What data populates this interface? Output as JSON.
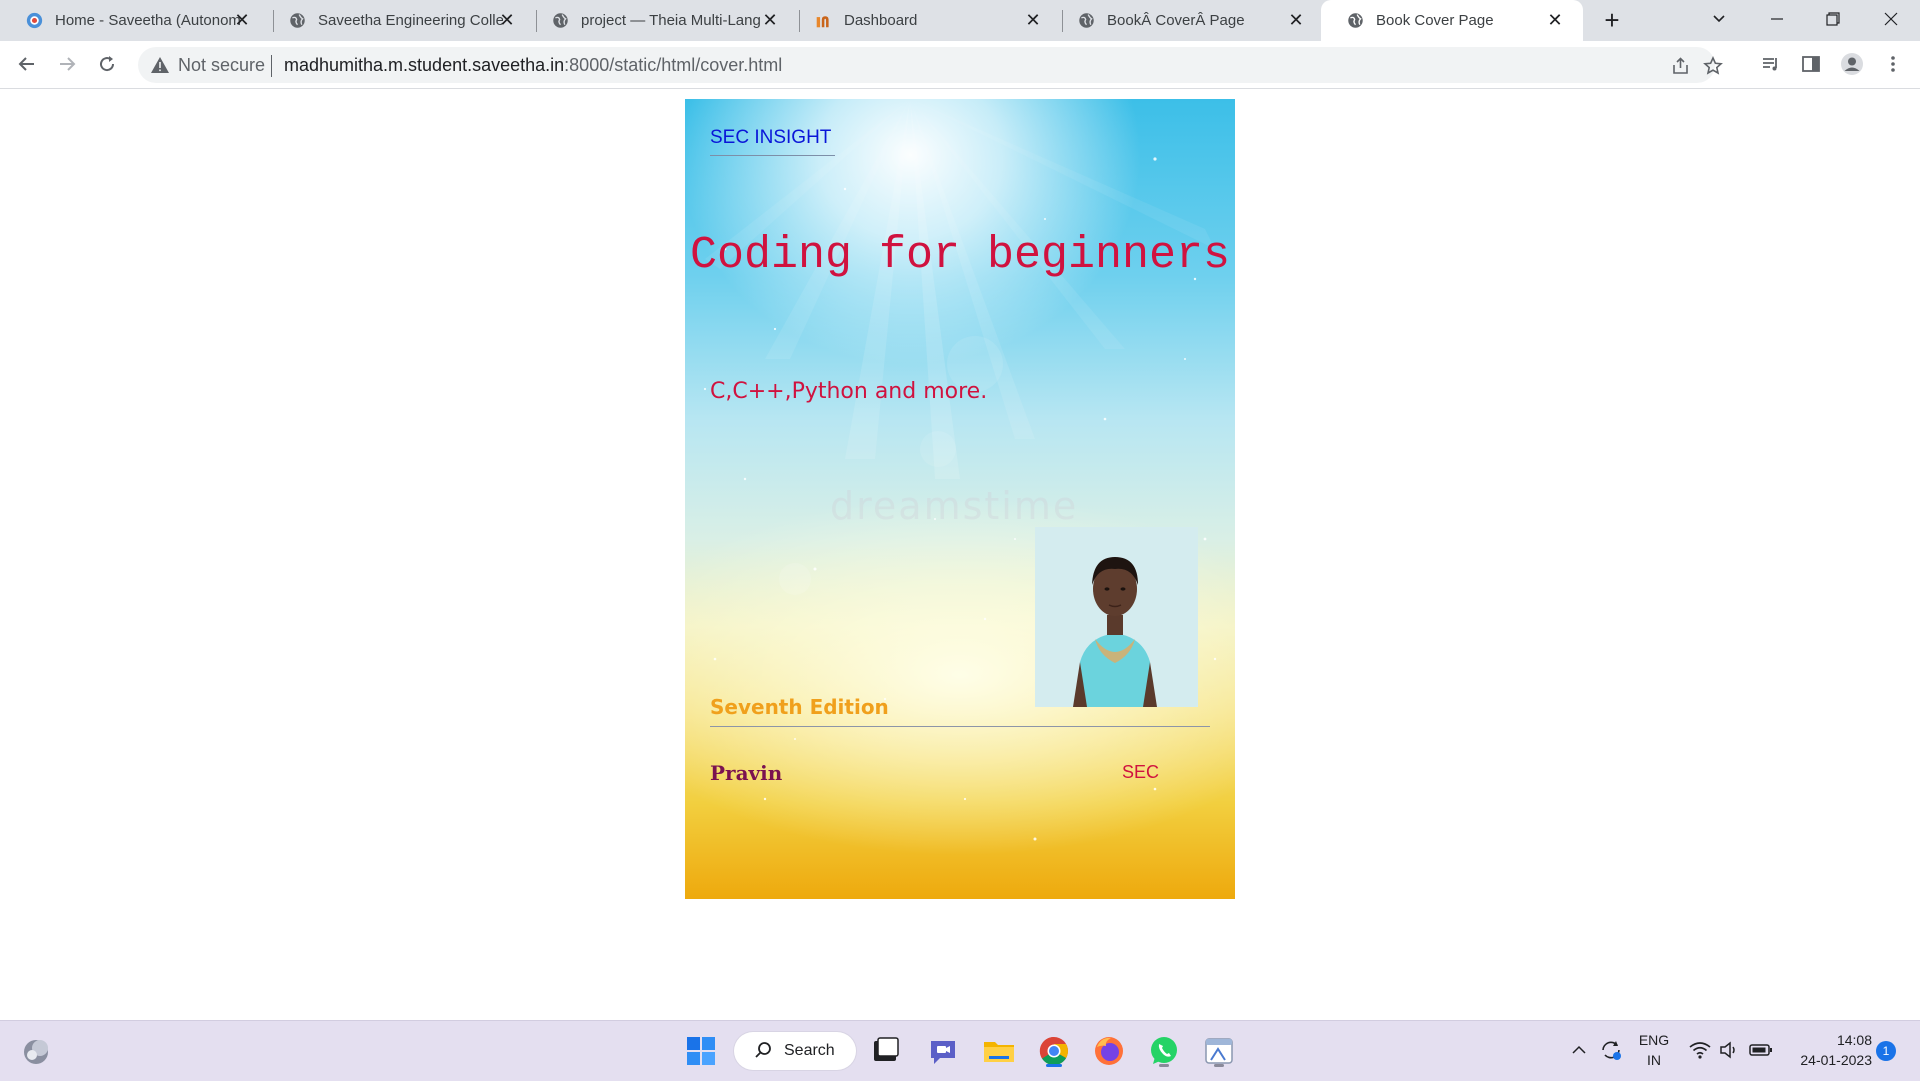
{
  "browser": {
    "tabs": [
      {
        "title": "Home - Saveetha (Autonom",
        "icon": "saveetha-favicon",
        "active": false
      },
      {
        "title": "Saveetha Engineering Colle",
        "icon": "globe-icon",
        "active": false
      },
      {
        "title": "project — Theia Multi-Lang",
        "icon": "globe-icon",
        "active": false
      },
      {
        "title": "Dashboard",
        "icon": "dashboard-favicon",
        "active": false
      },
      {
        "title": "BookÂ CoverÂ Page",
        "icon": "globe-icon",
        "active": false
      },
      {
        "title": "Book Cover Page",
        "icon": "globe-icon",
        "active": true
      }
    ],
    "new_tab_label": "+",
    "tab_close_label": "✕",
    "security_label": "Not secure",
    "url_host": "madhumitha.m.student.saveetha.in",
    "url_rest": ":8000/static/html/cover.html"
  },
  "cover": {
    "brand": "SEC INSIGHT",
    "title": "Coding for beginners",
    "subtitle": "C,C++,Python and more.",
    "watermark": "dreamstime",
    "edition": "Seventh Edition",
    "author": "Pravin",
    "publisher": "SEC",
    "colors": {
      "title": "#d0123f",
      "brand": "#0a16d8",
      "edition": "#f0a01c",
      "author": "#7a1250"
    }
  },
  "taskbar": {
    "search_label": "Search",
    "apps": [
      "start-icon",
      "search",
      "task-view-icon",
      "teams-chat-icon",
      "file-explorer-icon",
      "chrome-icon",
      "firefox-icon",
      "whatsapp-icon",
      "snipping-tool-icon"
    ],
    "language_line1": "ENG",
    "language_line2": "IN",
    "time": "14:08",
    "date": "24-01-2023",
    "notification_count": "1"
  }
}
